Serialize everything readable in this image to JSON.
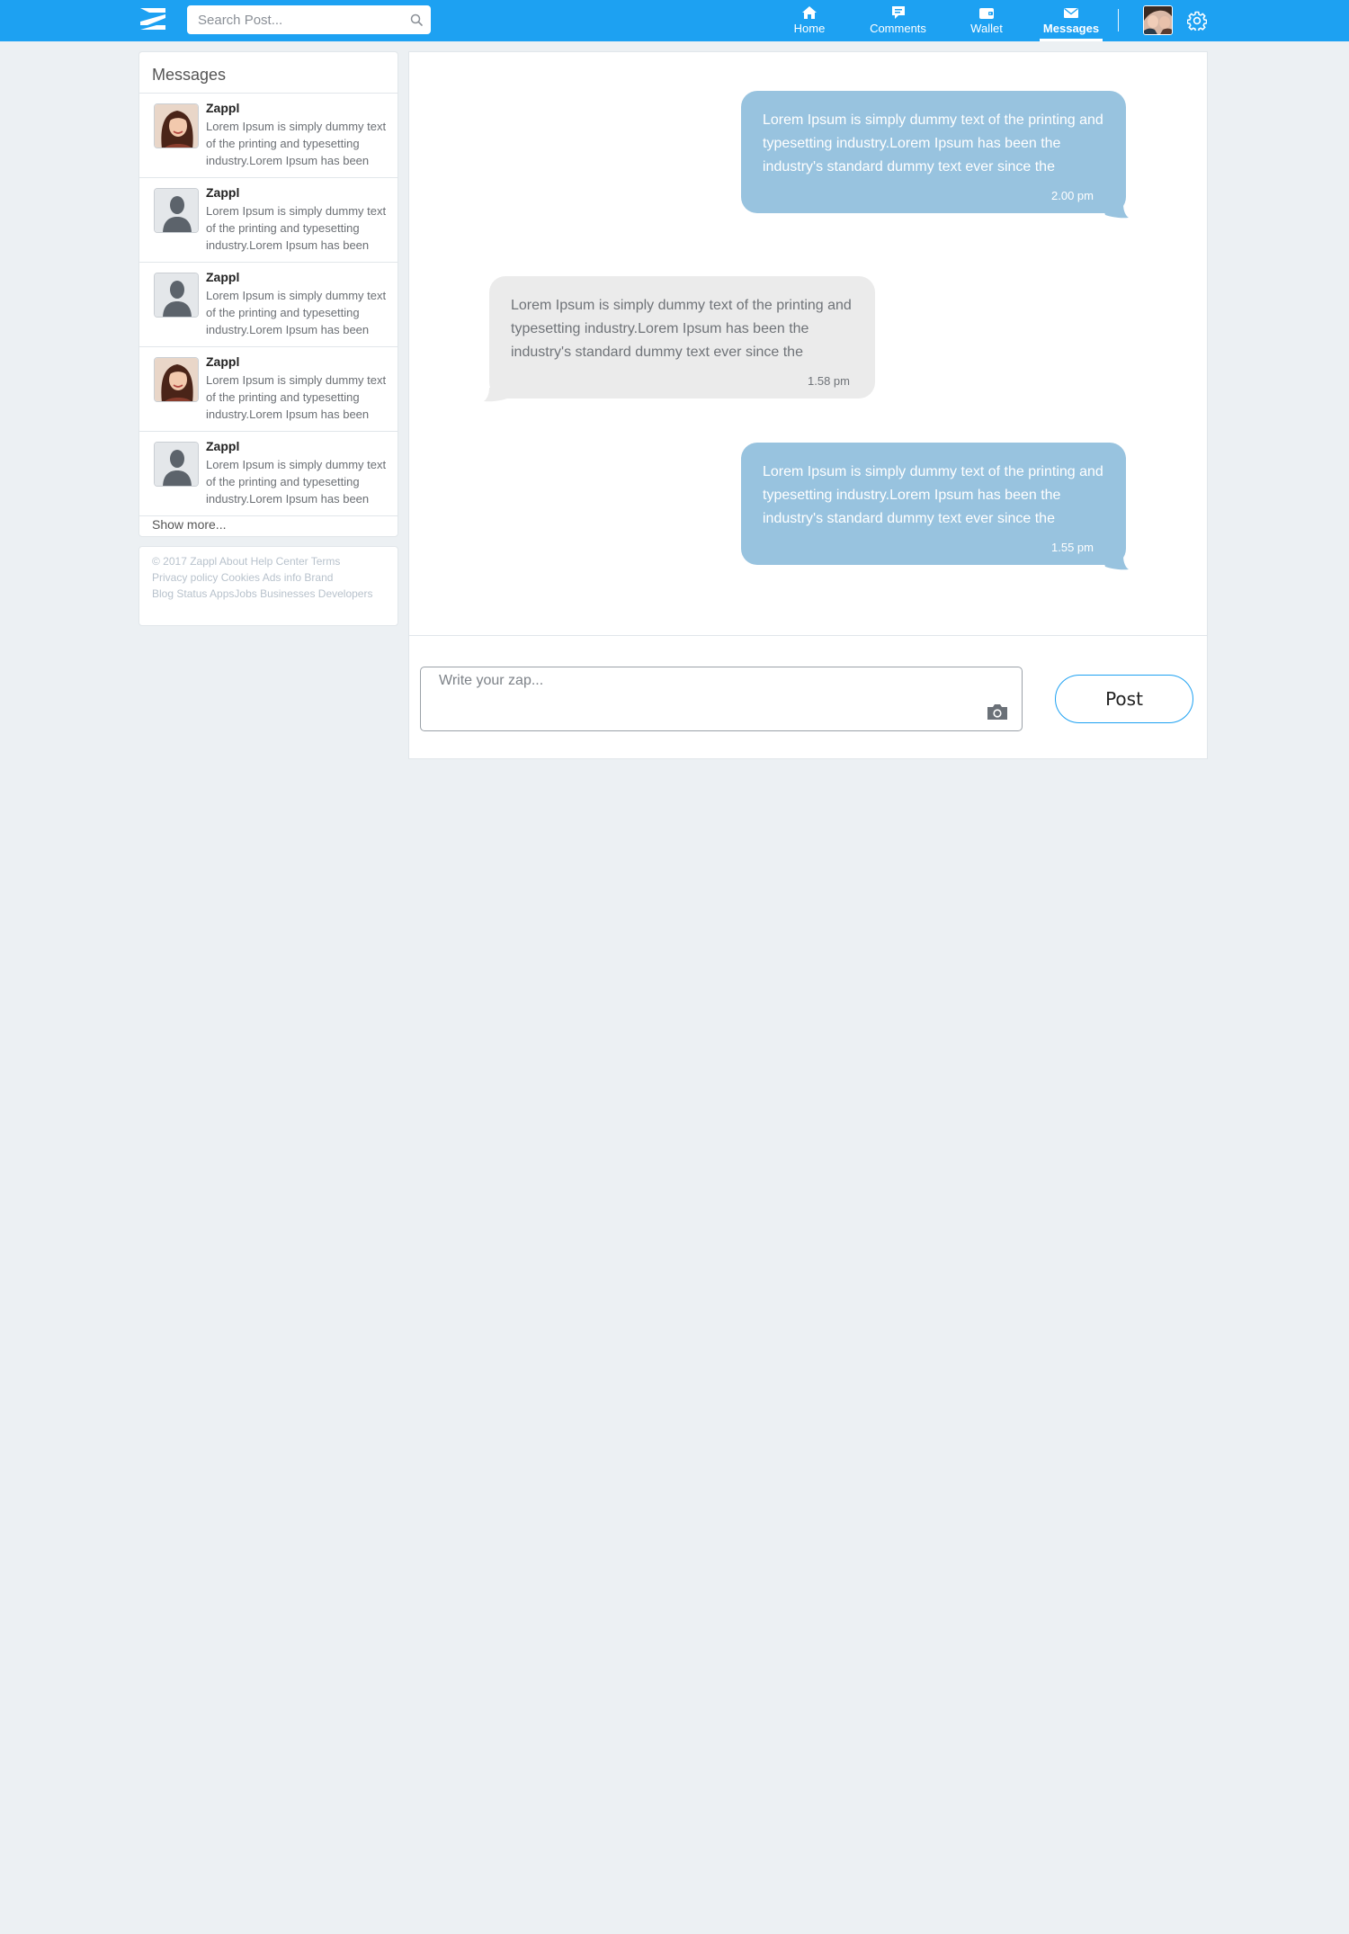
{
  "header": {
    "search_placeholder": "Search Post...",
    "nav": [
      {
        "label": "Home",
        "icon": "home-icon"
      },
      {
        "label": "Comments",
        "icon": "comment-icon"
      },
      {
        "label": "Wallet",
        "icon": "wallet-icon"
      },
      {
        "label": "Messages",
        "icon": "envelope-icon",
        "active": true
      }
    ]
  },
  "sidebar": {
    "title": "Messages",
    "conversations": [
      {
        "name": "Zappl",
        "preview": "Lorem Ipsum is simply dummy text of the printing and typesetting industry.Lorem Ipsum has been",
        "avatar": "photo"
      },
      {
        "name": "Zappl",
        "preview": "Lorem Ipsum is simply dummy text of the printing and typesetting industry.Lorem Ipsum has been",
        "avatar": "placeholder"
      },
      {
        "name": "Zappl",
        "preview": "Lorem Ipsum is simply dummy text of the printing and typesetting industry.Lorem Ipsum has been",
        "avatar": "placeholder"
      },
      {
        "name": "Zappl",
        "preview": "Lorem Ipsum is simply dummy text of the printing and typesetting industry.Lorem Ipsum has been",
        "avatar": "photo"
      },
      {
        "name": "Zappl",
        "preview": "Lorem Ipsum is simply dummy text of the printing and typesetting industry.Lorem Ipsum has been",
        "avatar": "placeholder"
      }
    ],
    "show_more": "Show more..."
  },
  "footer": {
    "line1": "© 2017 Zappl About Help Center Terms",
    "line2": "Privacy policy Cookies Ads info Brand",
    "line3": "Blog Status AppsJobs Businesses Developers"
  },
  "chat": {
    "messages": [
      {
        "from": "me",
        "text": "Lorem Ipsum is simply dummy text of the printing and typesetting industry.Lorem Ipsum has been the industry's standard dummy text ever since the",
        "time": "2.00 pm"
      },
      {
        "from": "them",
        "text": "Lorem Ipsum is simply dummy text of the printing and typesetting industry.Lorem Ipsum has been the industry's standard dummy text ever since the",
        "time": "1.58 pm"
      },
      {
        "from": "me",
        "text": "Lorem Ipsum is simply dummy text of the printing and typesetting industry.Lorem Ipsum has been the industry's standard dummy text ever since the",
        "time": "1.55 pm"
      }
    ],
    "compose_placeholder": "Write your zap...",
    "post_label": "Post"
  },
  "colors": {
    "brand_blue": "#1da1f2",
    "sent_bubble": "#98c3df",
    "received_bubble": "#ebebeb",
    "page_bg": "#ecf0f3"
  }
}
